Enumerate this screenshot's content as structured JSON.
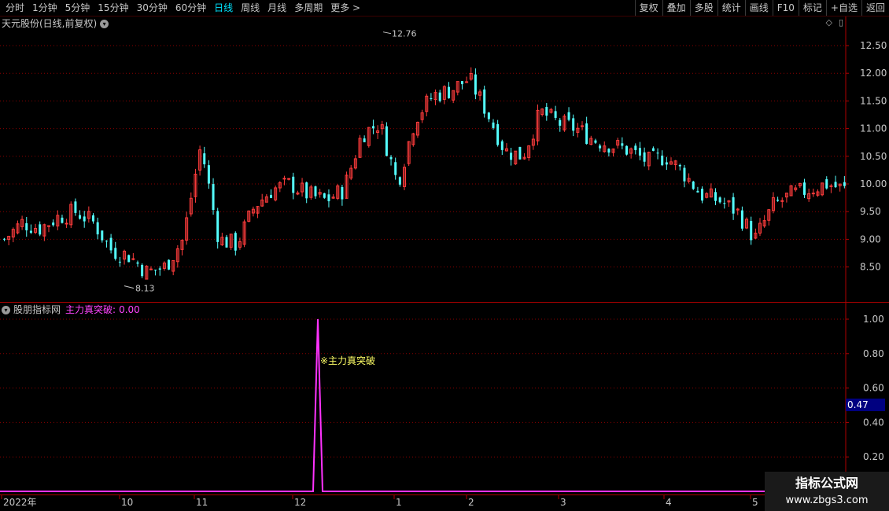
{
  "toolbar": {
    "periods": [
      "分时",
      "1分钟",
      "5分钟",
      "15分钟",
      "30分钟",
      "60分钟",
      "日线",
      "周线",
      "月线",
      "多周期",
      "更多 >"
    ],
    "active_period": "日线",
    "buttons": [
      "复权",
      "叠加",
      "多股",
      "统计",
      "画线",
      "F10",
      "标记",
      "+自选",
      "返回"
    ]
  },
  "main_pane": {
    "title": "天元股份(日线,前复权)",
    "high_label": "12.76",
    "low_label": "8.13",
    "price_axis": [
      "12.50",
      "12.00",
      "11.50",
      "11.00",
      "10.50",
      "10.00",
      "9.50",
      "9.00",
      "8.50"
    ]
  },
  "indicator_pane": {
    "source": "股朋指标网",
    "name": "主力真突破:",
    "value": "0.00",
    "annotation": "※主力真突破",
    "axis": [
      "1.00",
      "0.80",
      "0.60",
      "0.40",
      "0.20"
    ],
    "cursor_value": "0.47"
  },
  "time_axis": [
    "2022年",
    "10",
    "11",
    "12",
    "1",
    "2",
    "3",
    "4",
    "5"
  ],
  "colors": {
    "up": "#ff3c3c",
    "down": "#54ffff",
    "signal": "#ff33ff",
    "grid": "#8a0000"
  },
  "watermark": {
    "line1": "指标公式网",
    "line2": "www.zbgs3.com"
  },
  "chart_data": {
    "type": "candlestick",
    "price_high": 12.76,
    "price_low": 8.13,
    "ylim": [
      8.13,
      12.76
    ],
    "signal_series": {
      "name": "主力真突破",
      "ylim": [
        0,
        1.0
      ],
      "values": "zero except a single spike to 1.00 in mid-December 2022"
    },
    "approx_close_trend": [
      9.0,
      9.3,
      9.2,
      9.4,
      9.5,
      9.3,
      8.8,
      8.7,
      8.4,
      8.5,
      9.0,
      10.7,
      9.0,
      8.9,
      9.6,
      9.9,
      10.0,
      9.8,
      9.7,
      9.9,
      10.9,
      11.1,
      10.0,
      11.2,
      11.6,
      11.7,
      11.9,
      11.3,
      10.6,
      10.5,
      11.3,
      11.1,
      11.0,
      10.8,
      10.7,
      10.6,
      10.4,
      10.5,
      10.2,
      9.8,
      9.7,
      9.5,
      9.0,
      9.6,
      9.8,
      9.9,
      10.0,
      9.9
    ]
  }
}
